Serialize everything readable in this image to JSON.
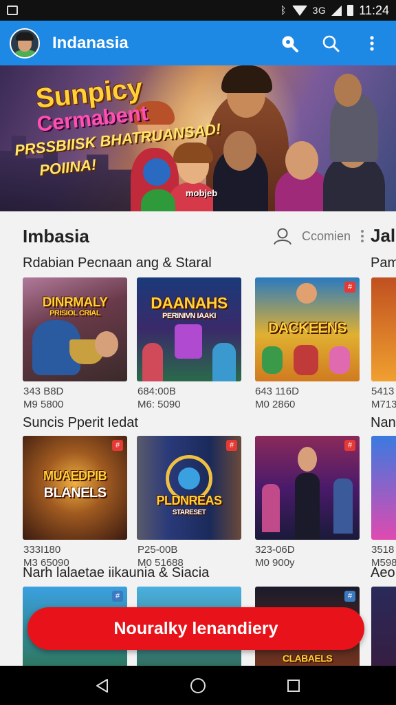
{
  "status_bar": {
    "network": "3G",
    "time": "11:24"
  },
  "app_bar": {
    "title": "Indanasia"
  },
  "banner": {
    "line1": "Sunpicy",
    "line2": "Cermabent",
    "line3": "PRSSBIISK BHATRUANSAD!",
    "line4": "POIINA!",
    "logo_text": "mobjeb"
  },
  "section": {
    "title": "Imbasia",
    "link_label": "Ccomien",
    "next_title": "Jal"
  },
  "rows": [
    {
      "label": "Rdabian Pecnaan ang & Staral",
      "next_label": "Pam",
      "tiles": [
        {
          "title": "DINRMALY",
          "subtitle": "PRISIOL CRIAL",
          "meta1": "343 B8D",
          "meta2": "M9 5800"
        },
        {
          "title": "DAANAHS",
          "subtitle": "PERINIVN IAAKI",
          "meta1": "684:00B",
          "meta2": "M6: 5090"
        },
        {
          "title": "DACKEENS",
          "subtitle": "",
          "meta1": "643 116D",
          "meta2": "M0 2860"
        }
      ],
      "next_meta1": "5413",
      "next_meta2": "M713"
    },
    {
      "label": "Suncis Pperit Iedat",
      "next_label": "Nan",
      "tiles": [
        {
          "title": "MUAEDPIB",
          "subtitle": "BLANELS",
          "meta1": "333I180",
          "meta2": "M3 65090"
        },
        {
          "title": "PLDNREAS",
          "subtitle": "STARESET",
          "meta1": "P25-00B",
          "meta2": "M0 51688"
        },
        {
          "title": "",
          "subtitle": "",
          "meta1": "323-06D",
          "meta2": "M0 900y"
        }
      ],
      "next_meta1": "3518",
      "next_meta2": "M598"
    },
    {
      "label": "Narh lalaetae iikaunia & Siacia",
      "next_label": "Aeo",
      "tiles": [
        {
          "title": "",
          "subtitle": "",
          "meta1": "",
          "meta2": ""
        },
        {
          "title": "",
          "subtitle": "",
          "meta1": "",
          "meta2": ""
        },
        {
          "title": "CLABAELS",
          "subtitle": "",
          "meta1": "",
          "meta2": ""
        }
      ]
    }
  ],
  "cta": {
    "label": "Nouralky lenandiery"
  },
  "colors": {
    "app_bar": "#1e88e5",
    "cta": "#e8131a",
    "status_bar": "#111111",
    "nav_bar": "#000000"
  }
}
